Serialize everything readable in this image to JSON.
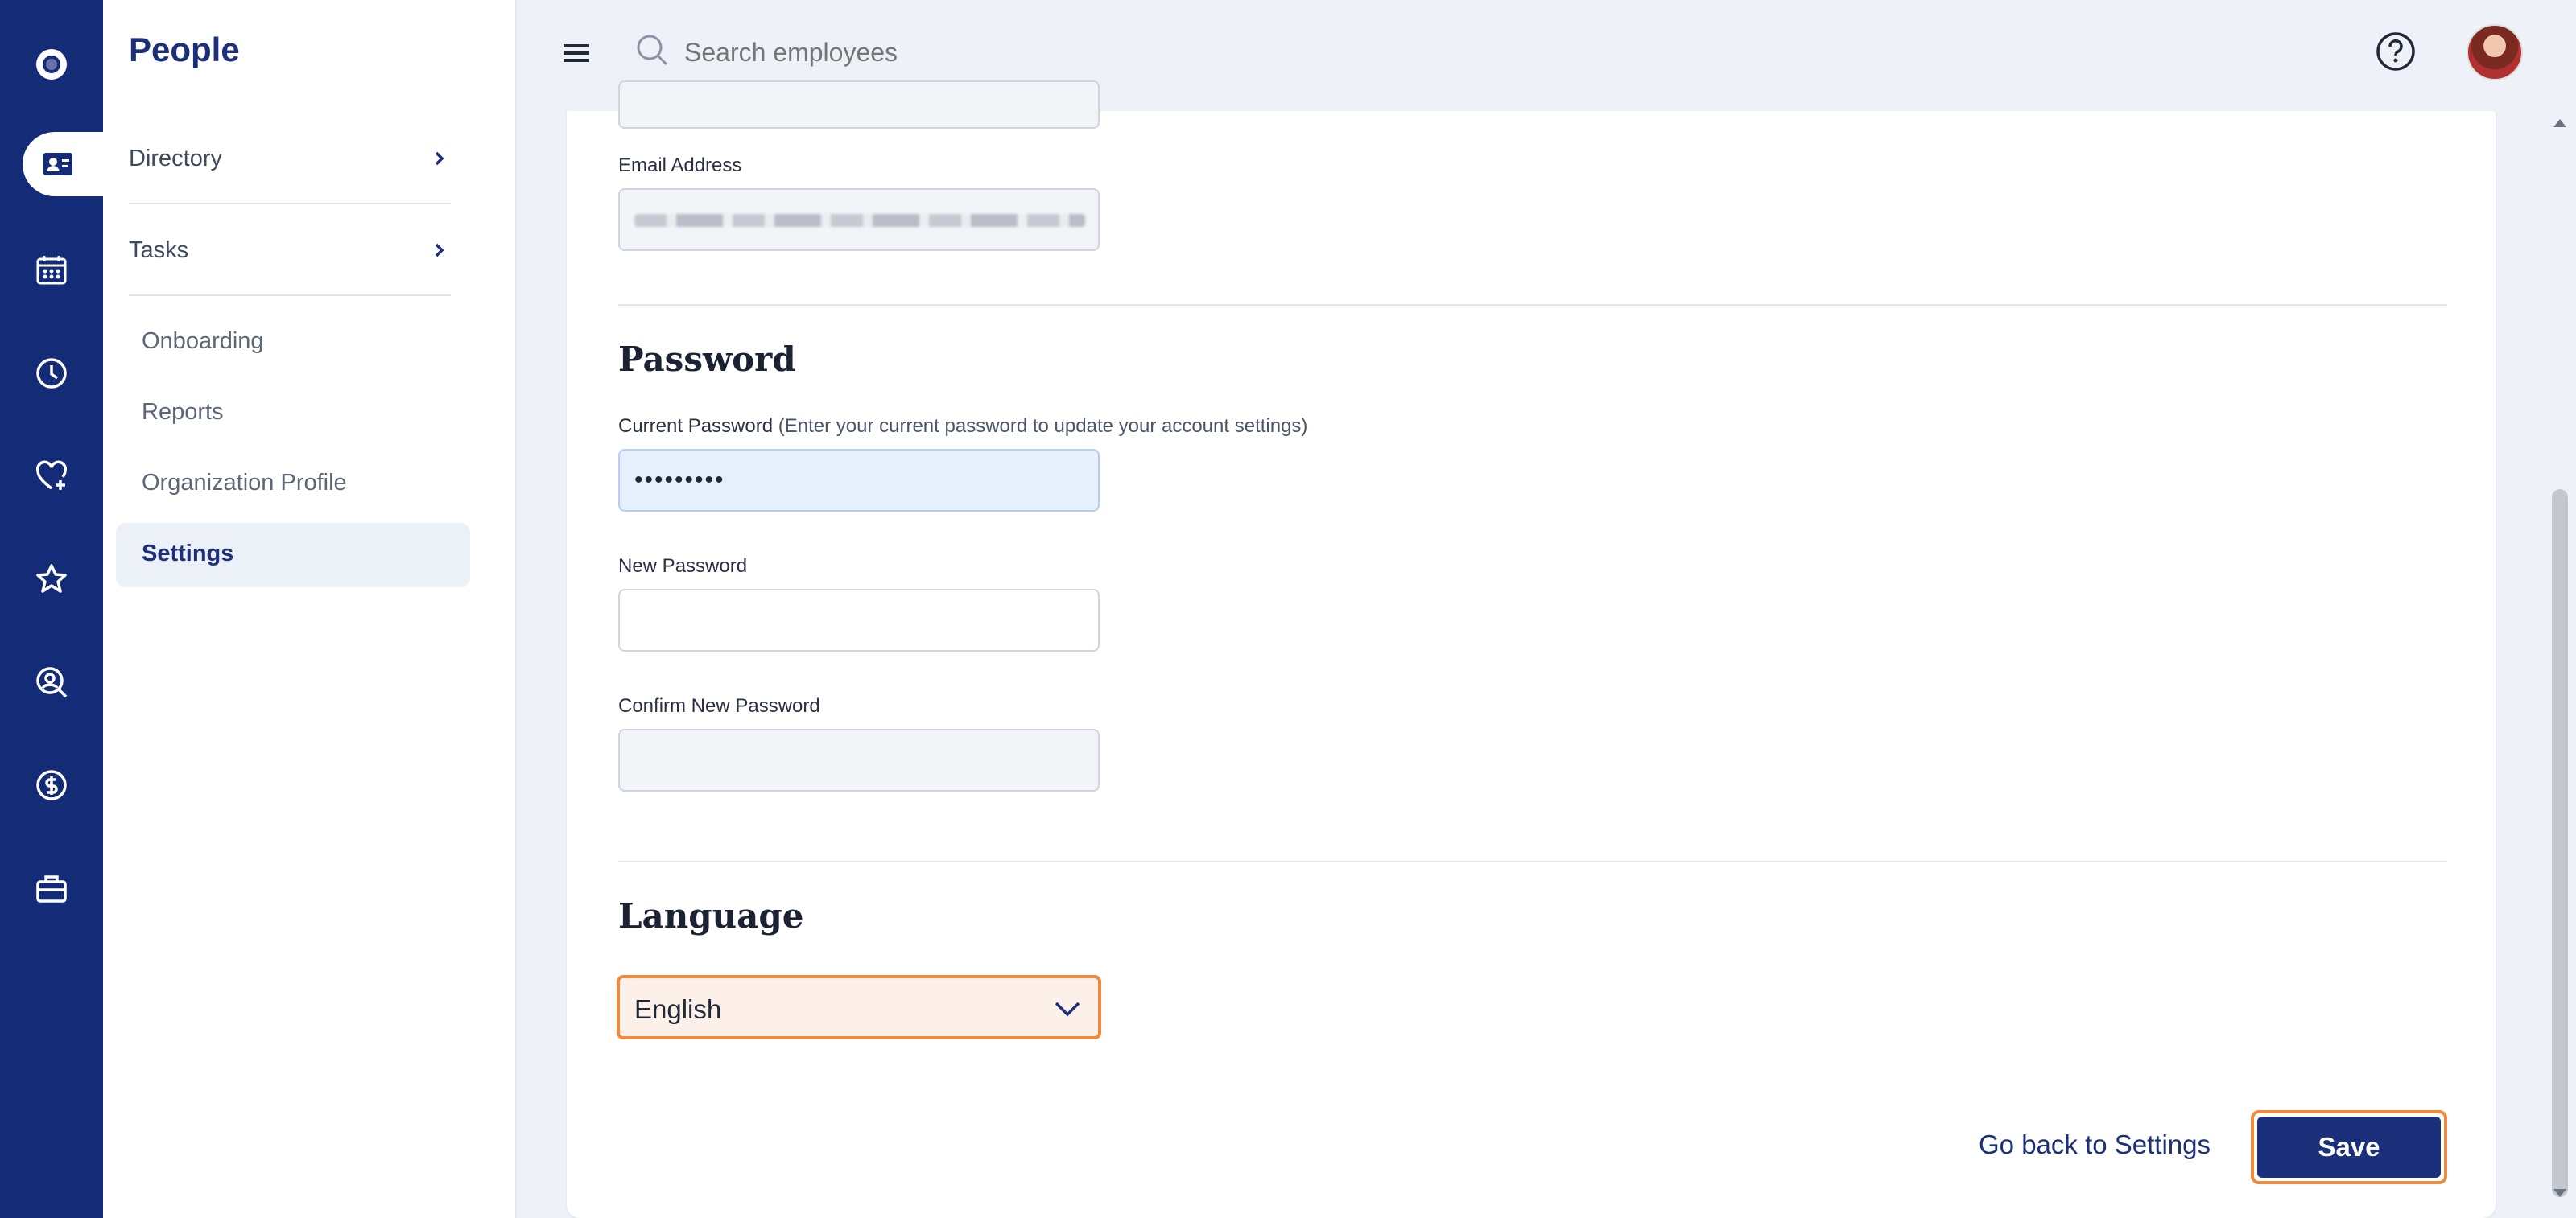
{
  "rail": {
    "items": [
      {
        "icon": "logo-icon"
      },
      {
        "icon": "id-card-icon",
        "active": true
      },
      {
        "icon": "calendar-icon"
      },
      {
        "icon": "clock-icon"
      },
      {
        "icon": "heart-plus-icon"
      },
      {
        "icon": "star-icon"
      },
      {
        "icon": "search-person-icon"
      },
      {
        "icon": "dollar-icon"
      },
      {
        "icon": "briefcase-icon"
      }
    ]
  },
  "nav": {
    "title": "People",
    "directory": "Directory",
    "tasks": "Tasks",
    "sub_items": [
      "Onboarding",
      "Reports",
      "Organization Profile"
    ],
    "active_item": "Settings"
  },
  "topbar": {
    "search_placeholder": "Search employees"
  },
  "form": {
    "email_label": "Email Address",
    "password_title": "Password",
    "current_password_label": "Current Password",
    "current_password_hint": "(Enter your current password to update your account settings)",
    "current_password_value": "•••••••••",
    "new_password_label": "New Password",
    "confirm_password_label": "Confirm New Password",
    "language_title": "Language",
    "language_value": "English"
  },
  "actions": {
    "back_link": "Go back to Settings",
    "save": "Save"
  },
  "colors": {
    "brand": "#142b78",
    "accent_highlight": "#f08a3c",
    "nav_text": "#1b2f7a"
  }
}
